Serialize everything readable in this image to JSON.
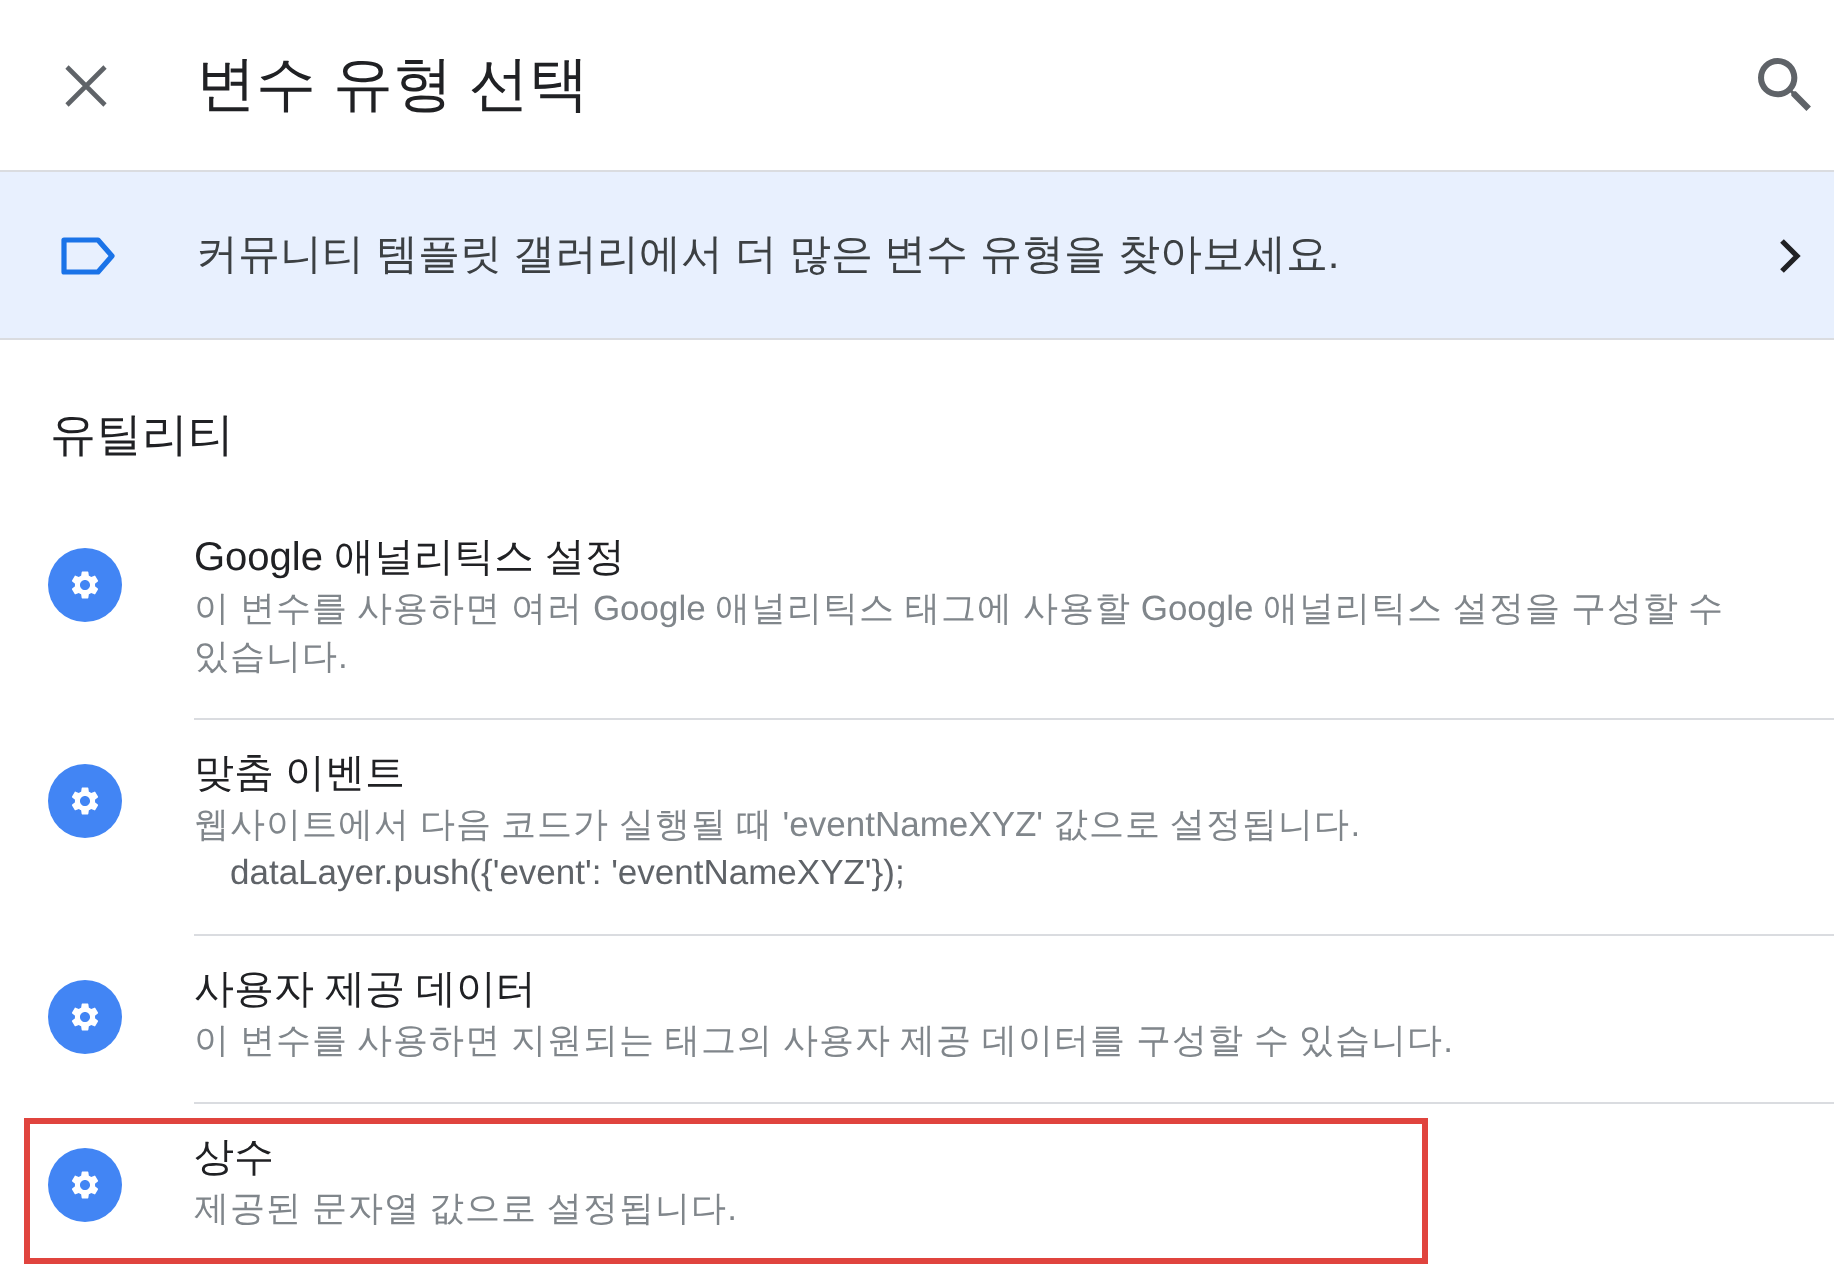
{
  "header": {
    "title": "변수 유형 선택"
  },
  "banner": {
    "text": "커뮤니티 템플릿 갤러리에서 더 많은 변수 유형을 찾아보세요."
  },
  "section": {
    "heading": "유틸리티",
    "items": [
      {
        "title": "Google 애널리틱스 설정",
        "description": "이 변수를 사용하면 여러 Google 애널리틱스 태그에 사용할 Google 애널리틱스 설정을 구성할 수 있습니다.",
        "highlighted": false
      },
      {
        "title": "맞춤 이벤트",
        "description": "웹사이트에서 다음 코드가 실행될 때 'eventNameXYZ' 값으로 설정됩니다.",
        "code": "dataLayer.push({'event': 'eventNameXYZ'});",
        "highlighted": false
      },
      {
        "title": "사용자 제공 데이터",
        "description": "이 변수를 사용하면 지원되는 태그의 사용자 제공 데이터를 구성할 수 있습니다.",
        "highlighted": false
      },
      {
        "title": "상수",
        "description": "제공된 문자열 값으로 설정됩니다.",
        "highlighted": true
      }
    ]
  }
}
